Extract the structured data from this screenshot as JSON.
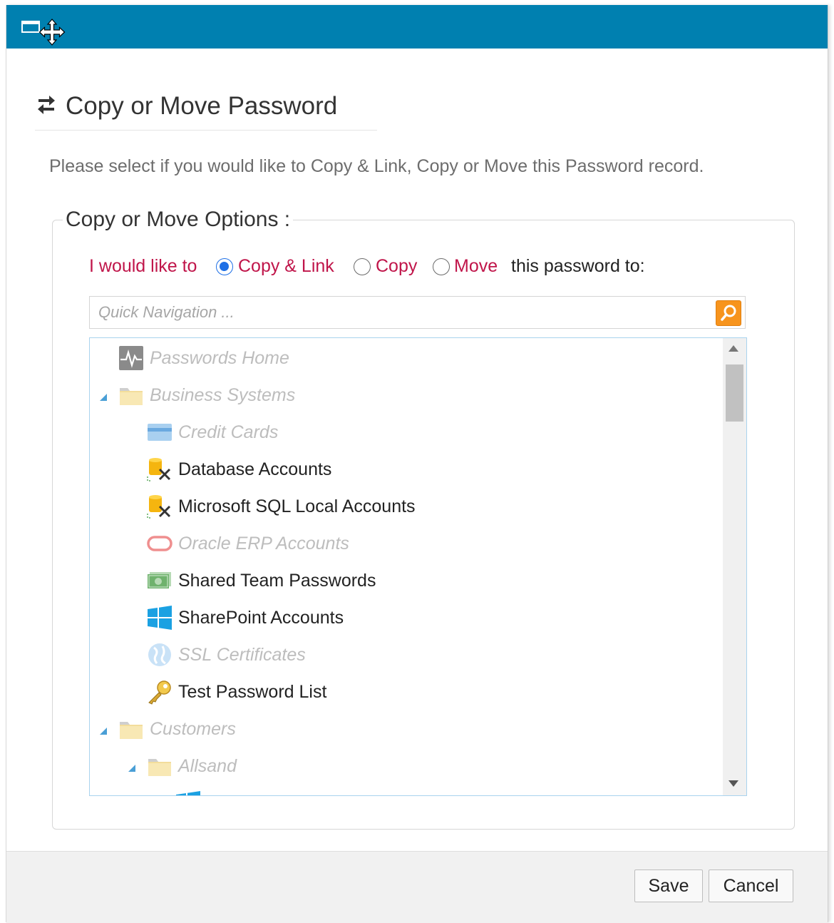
{
  "header": {
    "title": "Copy or Move Password",
    "icon": "swap-arrows-icon"
  },
  "instructions": "Please select if you would like to Copy & Link, Copy or Move this Password record.",
  "options": {
    "legend": "Copy or Move Options :",
    "prefix": "I would like to",
    "choices": [
      {
        "label": "Copy & Link",
        "checked": true
      },
      {
        "label": "Copy",
        "checked": false
      },
      {
        "label": "Move",
        "checked": false
      }
    ],
    "suffix": "this password to:"
  },
  "search": {
    "placeholder": "Quick Navigation ...",
    "value": "",
    "button_icon": "search-icon"
  },
  "tree": {
    "items": [
      {
        "label": "Passwords Home",
        "icon": "pulse-icon",
        "enabled": false
      },
      {
        "label": "Business Systems",
        "icon": "folder-icon",
        "enabled": false,
        "expanded": true
      },
      {
        "label": "Credit Cards",
        "icon": "credit-card-icon",
        "enabled": false
      },
      {
        "label": "Database Accounts",
        "icon": "database-icon",
        "enabled": true
      },
      {
        "label": "Microsoft SQL Local Accounts",
        "icon": "database-icon",
        "enabled": true
      },
      {
        "label": "Oracle ERP Accounts",
        "icon": "oracle-icon",
        "enabled": false
      },
      {
        "label": "Shared Team Passwords",
        "icon": "money-icon",
        "enabled": true
      },
      {
        "label": "SharePoint Accounts",
        "icon": "windows-icon",
        "enabled": true
      },
      {
        "label": "SSL Certificates",
        "icon": "globe-icon",
        "enabled": false
      },
      {
        "label": "Test Password List",
        "icon": "key-icon",
        "enabled": true
      },
      {
        "label": "Customers",
        "icon": "folder-icon",
        "enabled": false,
        "expanded": true
      },
      {
        "label": "Allsand",
        "icon": "folder-icon",
        "enabled": false,
        "expanded": true
      }
    ]
  },
  "footer": {
    "save_label": "Save",
    "cancel_label": "Cancel"
  },
  "colors": {
    "titlebar": "#0080b0",
    "option_label": "#c0154a",
    "radio_selected": "#1d6fe6",
    "search_button": "#f7941d"
  }
}
